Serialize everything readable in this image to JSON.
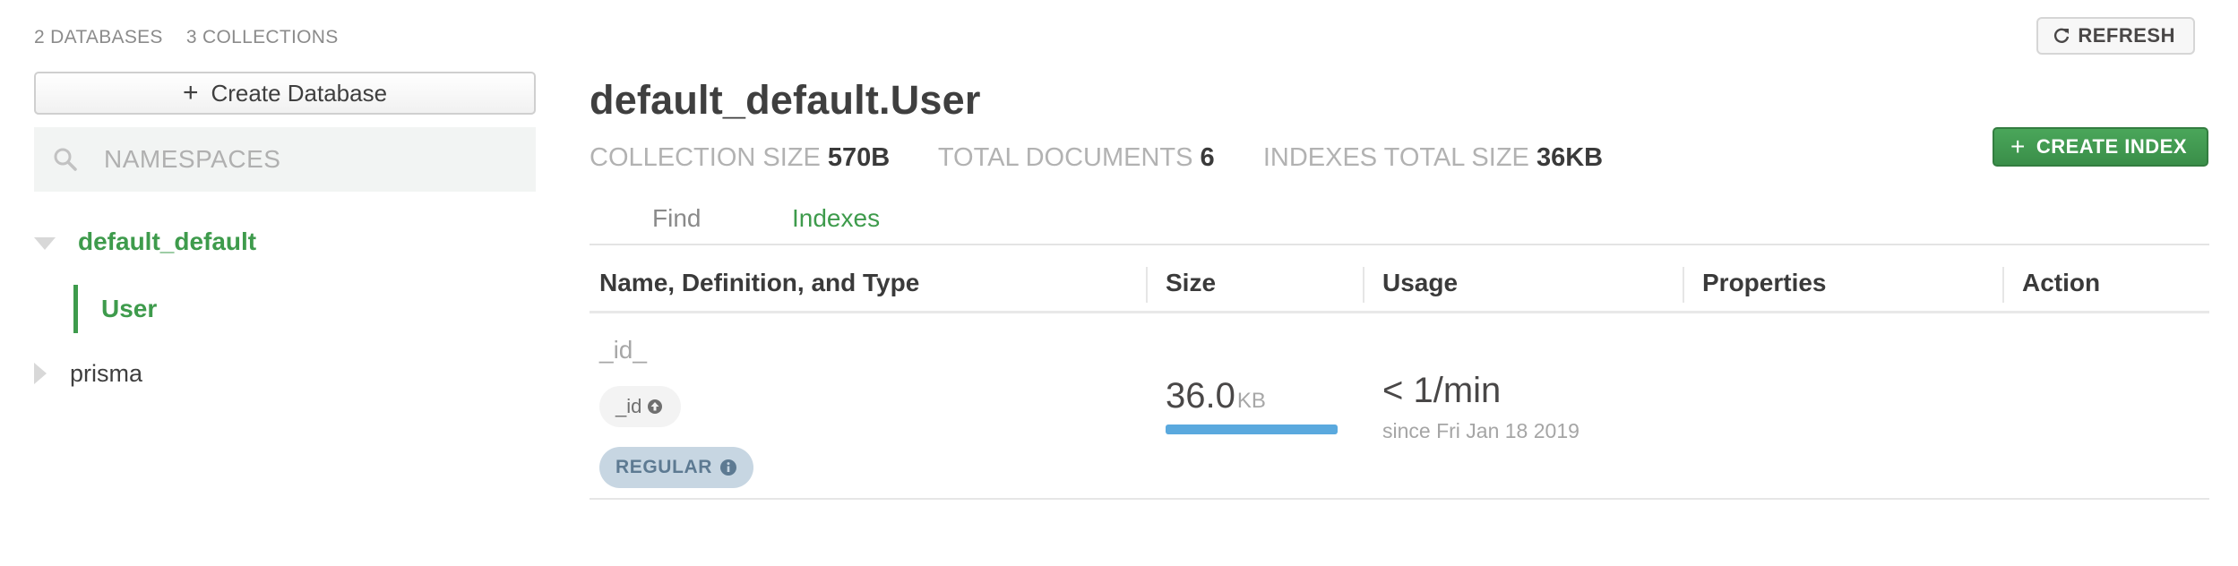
{
  "header": {
    "databases_count": "2 DATABASES",
    "collections_count": "3 COLLECTIONS",
    "refresh_label": "REFRESH"
  },
  "sidebar": {
    "create_database_label": "Create Database",
    "search_placeholder": "NAMESPACES",
    "databases": [
      {
        "name": "default_default",
        "expanded": true,
        "collections": [
          "User"
        ]
      },
      {
        "name": "prisma",
        "expanded": false,
        "collections": []
      }
    ]
  },
  "collection": {
    "title": "default_default.User",
    "stats": {
      "size_label": "COLLECTION SIZE",
      "size_value": "570B",
      "docs_label": "TOTAL DOCUMENTS",
      "docs_value": "6",
      "indexes_label": "INDEXES TOTAL SIZE",
      "indexes_value": "36KB"
    },
    "create_index_label": "CREATE INDEX",
    "tabs": [
      {
        "label": "Find",
        "active": false
      },
      {
        "label": "Indexes",
        "active": true
      }
    ]
  },
  "indexes_table": {
    "columns": [
      "Name, Definition, and Type",
      "Size",
      "Usage",
      "Properties",
      "Action"
    ],
    "rows": [
      {
        "name": "_id_",
        "field": "_id",
        "type": "REGULAR",
        "size_value": "36.0",
        "size_unit": "KB",
        "size_fraction": 1.0,
        "usage": "< 1/min",
        "since": "since Fri Jan 18 2019"
      }
    ]
  },
  "colors": {
    "accent_green": "#3e9b4c",
    "size_bar": "#5aa9de",
    "type_badge_bg": "#c7d6e2"
  },
  "icons": {
    "refresh": "refresh-icon",
    "search": "search-icon",
    "plus": "plus-icon",
    "ascending": "arrow-up-circle-icon",
    "info": "info-icon"
  }
}
